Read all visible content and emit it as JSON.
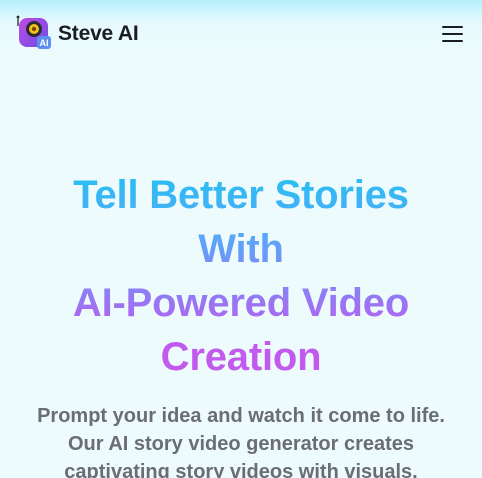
{
  "header": {
    "brand_name": "Steve AI",
    "logo_badge": "AI",
    "menu_icon": "hamburger-menu-icon"
  },
  "hero": {
    "title_lines": [
      "Tell Better Stories",
      "With",
      "AI-Powered Video",
      "Creation"
    ],
    "subtitle_lines": [
      "Prompt your idea and watch it come to life.",
      "Our AI story video generator creates",
      "captivating story videos with visuals."
    ]
  },
  "colors": {
    "gradient_start": "#22c2f3",
    "gradient_mid": "#8f7df4",
    "gradient_end": "#c35bec",
    "text_dark": "#1c1d22",
    "text_gray": "#6a6e74",
    "background": "#eefbfd"
  }
}
